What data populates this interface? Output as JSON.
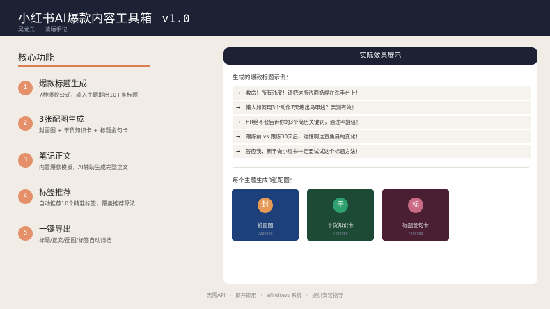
{
  "header": {
    "title": "小红书AI爆款内容工具箱",
    "version": "v1.0",
    "author": "吴龙元",
    "separator": "·",
    "brand": "读睡手记"
  },
  "features": {
    "title": "核心功能",
    "items": [
      {
        "num": "1",
        "title": "爆款标题生成",
        "desc": "7种爆款公式，输入主题即出10+条标题"
      },
      {
        "num": "2",
        "title": "3张配图生成",
        "desc": "封面图 + 干货知识卡 + 标题金句卡"
      },
      {
        "num": "3",
        "title": "笔记正文",
        "desc": "内置爆款模板，AI辅助生成完整正文"
      },
      {
        "num": "4",
        "title": "标签推荐",
        "desc": "自动推荐10个精准标签，覆盖推荐算法"
      },
      {
        "num": "5",
        "title": "一键导出",
        "desc": "标题/正文/配图/标签自动归档"
      }
    ]
  },
  "demo": {
    "title": "实际效果展示",
    "examples_label": "生成的爆款标题示例：",
    "arrow": "→",
    "examples": [
      "救命！所有油皮！请把这瓶洗面奶焊在洗手台上！",
      "懒人如何用3个动作7天练出马甲线？亲测有效！",
      "HR绝不会告诉你的3个简历关键词，通过率翻倍！",
      "跟练前 vs 跟练30天后，谁懂啊这直角肩的变化！",
      "答应我，新手做小红书一定要试试这个标题方法！"
    ],
    "cards_label": "每个主题生成3张配图：",
    "cards": [
      {
        "icon_char": "封",
        "label": "封面图",
        "size": "720x960",
        "bg": "#1d3f7a",
        "accent": "#e59a55"
      },
      {
        "icon_char": "干",
        "label": "干货知识卡",
        "size": "720x960",
        "bg": "#1d4a35",
        "accent": "#2fa070"
      },
      {
        "icon_char": "标",
        "label": "标题金句卡",
        "size": "720x960",
        "bg": "#4a1f33",
        "accent": "#c96b84"
      }
    ]
  },
  "footer": {
    "items": [
      "无需API",
      "即开即用",
      "Windows 系统",
      "提供安装指导"
    ],
    "separator": "·"
  },
  "colors": {
    "header_bg": "#1c2234",
    "accent": "#e4916b",
    "page_bg": "#f1ede6"
  }
}
